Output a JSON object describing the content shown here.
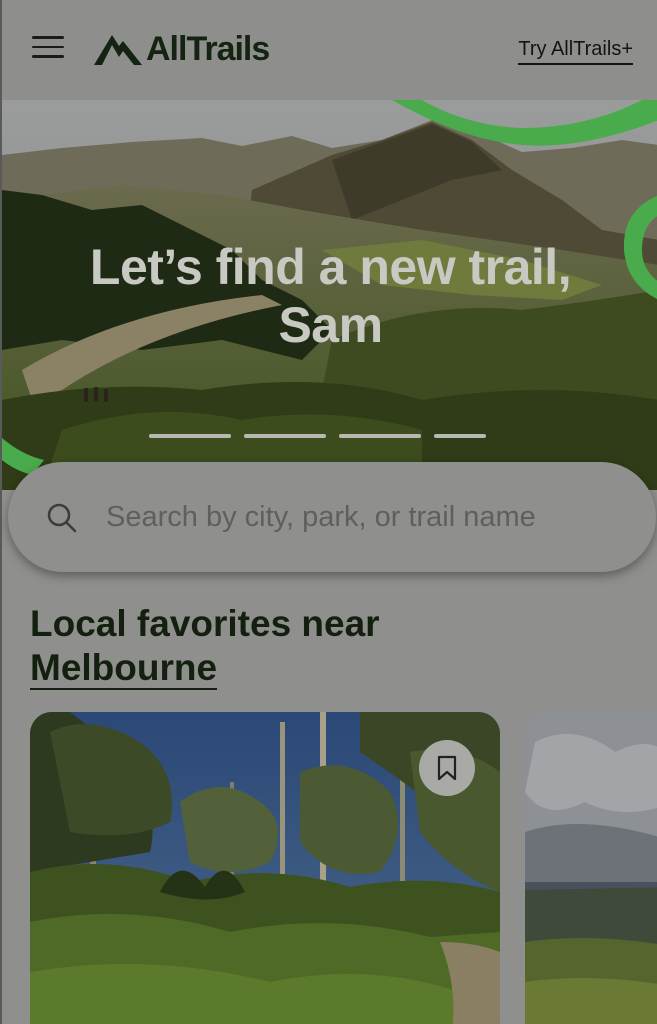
{
  "header": {
    "brand": "AllTrails",
    "cta": "Try AllTrails+"
  },
  "hero": {
    "title_line1": "Let’s find a new trail,",
    "title_line2": "Sam",
    "slides": [
      {
        "active": true
      },
      {
        "active": false
      },
      {
        "active": false
      },
      {
        "active": false
      }
    ]
  },
  "search": {
    "placeholder": "Search by city, park, or trail name"
  },
  "section": {
    "title": "Local favorites near",
    "location": "Melbourne"
  },
  "colors": {
    "brand_green": "#4aab4c",
    "text_dark": "#14200f",
    "overlay_grey": "#8f8f8d"
  },
  "icons": {
    "menu": "hamburger-menu-icon",
    "logo": "mountain-logo-icon",
    "search": "search-icon",
    "bookmark": "bookmark-icon"
  }
}
